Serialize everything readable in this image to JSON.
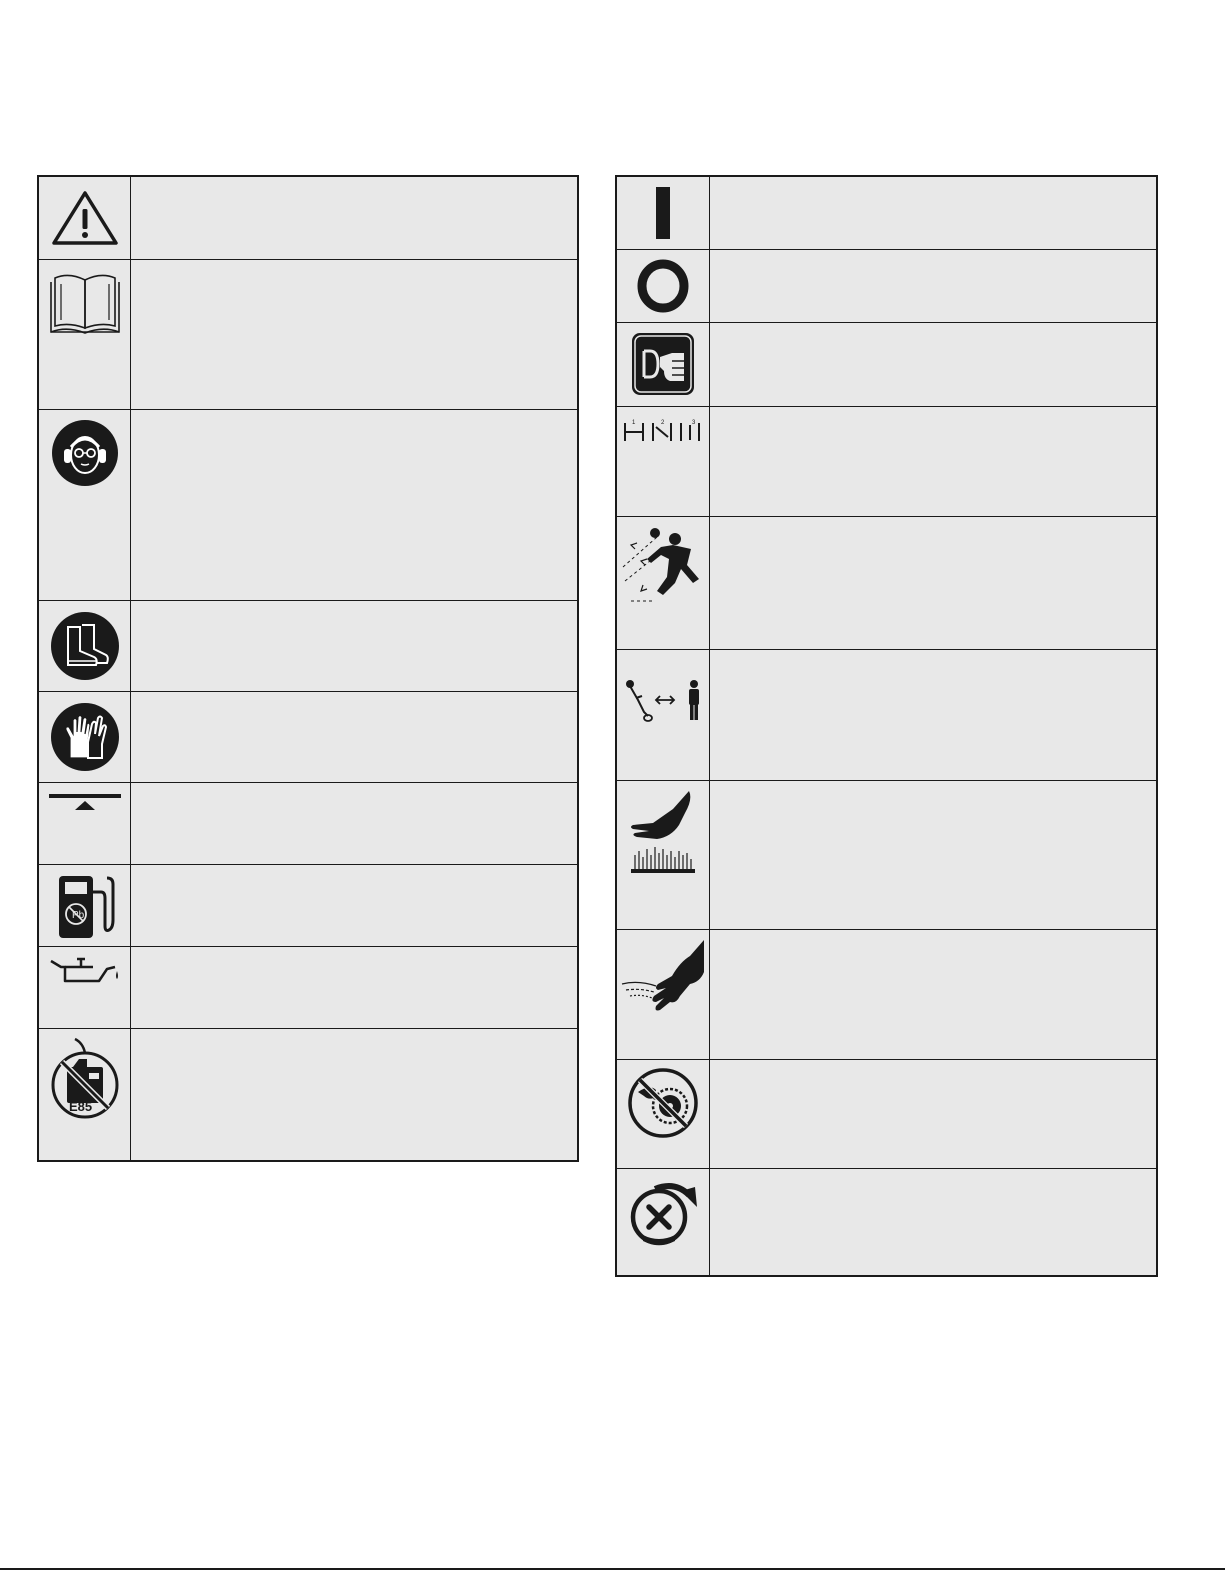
{
  "left_symbols": [
    {
      "icon": "warning-triangle-icon",
      "description": ""
    },
    {
      "icon": "operators-manual-icon",
      "description": ""
    },
    {
      "icon": "eye-ear-protection-icon",
      "description": ""
    },
    {
      "icon": "protective-boots-icon",
      "description": ""
    },
    {
      "icon": "protective-gloves-icon",
      "description": ""
    },
    {
      "icon": "choke-primer-icon",
      "description": ""
    },
    {
      "icon": "unleaded-fuel-icon",
      "description": ""
    },
    {
      "icon": "oil-can-icon",
      "description": ""
    },
    {
      "icon": "no-e85-fuel-icon",
      "description": ""
    }
  ],
  "right_symbols": [
    {
      "icon": "on-switch-icon",
      "description": ""
    },
    {
      "icon": "off-switch-icon",
      "description": ""
    },
    {
      "icon": "primer-bulb-press-icon",
      "description": ""
    },
    {
      "icon": "choke-positions-icon",
      "description": ""
    },
    {
      "icon": "thrown-objects-icon",
      "description": ""
    },
    {
      "icon": "keep-bystanders-away-icon",
      "description": ""
    },
    {
      "icon": "hot-surface-icon",
      "description": ""
    },
    {
      "icon": "rotating-line-hand-icon",
      "description": ""
    },
    {
      "icon": "no-blade-icon",
      "description": ""
    },
    {
      "icon": "do-not-pull-rotate-icon",
      "description": ""
    }
  ],
  "icon_labels": {
    "e85": "E85"
  },
  "colors": {
    "table_background": "#e8e8e8",
    "border": "#1a1a1a",
    "icon": "#1a1a1a"
  }
}
